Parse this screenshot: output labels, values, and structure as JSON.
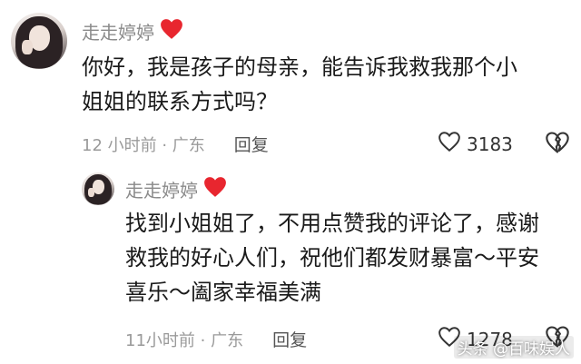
{
  "comment": {
    "username": "走走婷婷",
    "text_line1": "你好，我是孩子的母亲，能告诉我救我那个小",
    "text_line2": "姐姐的联系方式吗？",
    "time_location": "12 小时前 · 广东",
    "reply_label": "回复",
    "likes": "3183"
  },
  "reply": {
    "username": "走走婷婷",
    "text_line1": "找到小姐姐了，不用点赞我的评论了，感谢",
    "text_line2": "救我的好心人们，祝他们都发财暴富～平安",
    "text_line3": "喜乐～阖家幸福美满",
    "time_location": "11小时前 · 广东",
    "reply_label": "回复",
    "likes": "1278"
  },
  "watermark": "头条 @百味娱人",
  "icons": {
    "heart_emoji": "red-heart-icon",
    "like": "heart-outline-icon",
    "dislike": "broken-heart-icon"
  },
  "colors": {
    "heart_red": "#e8262f",
    "meta_gray": "#9a9a9a",
    "text_dark": "#1a1a1a"
  }
}
